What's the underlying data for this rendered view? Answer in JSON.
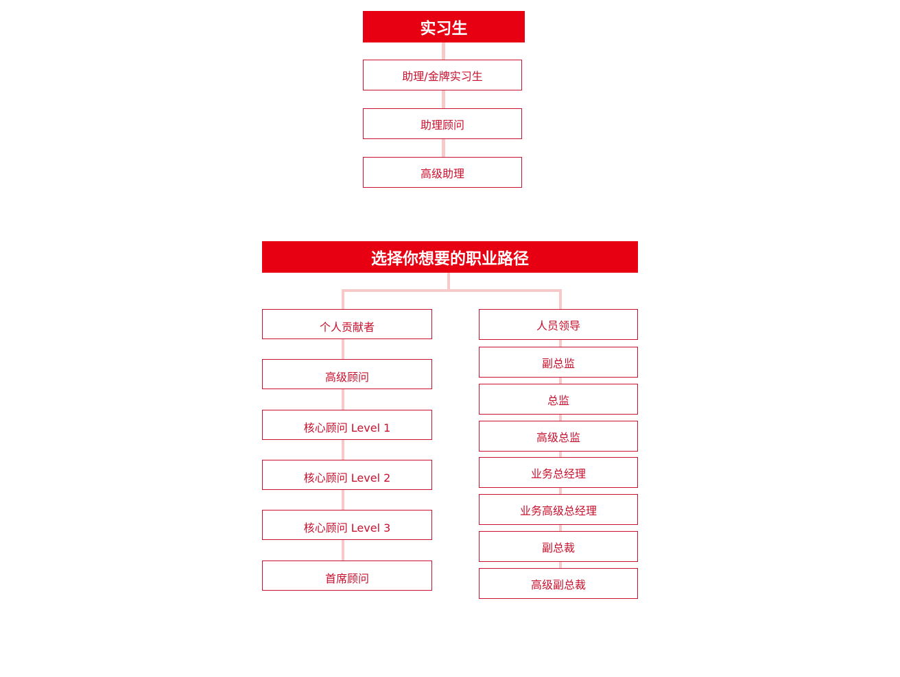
{
  "intern_chart": {
    "title": "实习生",
    "steps": [
      "助理/金牌实习生",
      "助理顾问",
      "高级助理"
    ]
  },
  "career_chart": {
    "title": "选择你想要的职业路径",
    "individual_track": [
      "个人贡献者",
      "高级顾问",
      "核心顾问 Level 1",
      "核心顾问 Level 2",
      "核心顾问 Level 3",
      "首席顾问"
    ],
    "leadership_track": [
      "人员领导",
      "副总监",
      "总监",
      "高级总监",
      "业务总经理",
      "业务高级总经理",
      "副总裁",
      "高级副总裁"
    ]
  },
  "colors": {
    "header_fill": "#e60012",
    "node_border": "#c8102e",
    "node_text": "#c8102e",
    "connector": "#f7c9c9"
  }
}
